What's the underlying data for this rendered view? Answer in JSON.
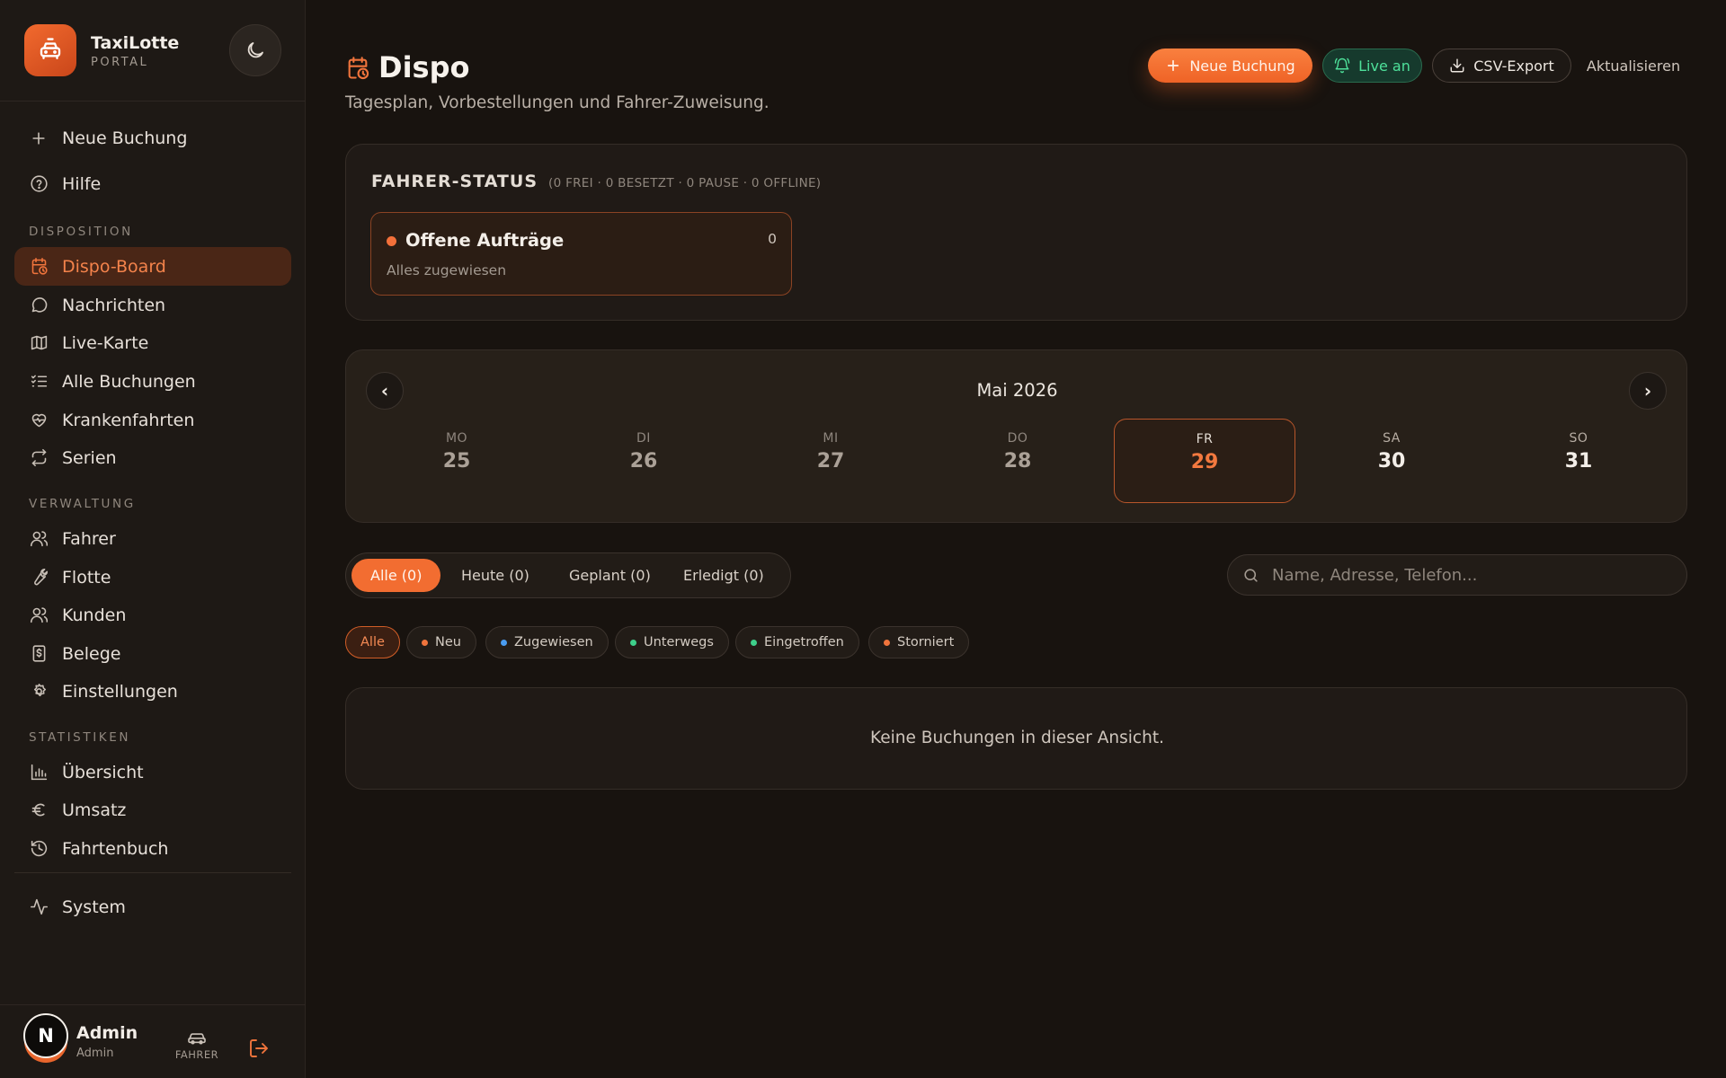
{
  "brand": {
    "name": "TaxiLotte",
    "sub": "PORTAL"
  },
  "sidebar": {
    "top_items": [
      {
        "label": "Neue Buchung",
        "icon": "plus-icon"
      },
      {
        "label": "Hilfe",
        "icon": "help-circle-icon"
      }
    ],
    "sections": [
      {
        "label": "DISPOSITION",
        "items": [
          {
            "label": "Dispo-Board",
            "icon": "calendar-clock-icon",
            "active": true
          },
          {
            "label": "Nachrichten",
            "icon": "message-icon"
          },
          {
            "label": "Live-Karte",
            "icon": "map-icon"
          },
          {
            "label": "Alle Buchungen",
            "icon": "list-checks-icon"
          },
          {
            "label": "Krankenfahrten",
            "icon": "heart-pulse-icon"
          },
          {
            "label": "Serien",
            "icon": "repeat-icon"
          }
        ]
      },
      {
        "label": "VERWALTUNG",
        "items": [
          {
            "label": "Fahrer",
            "icon": "users-icon"
          },
          {
            "label": "Flotte",
            "icon": "wrench-icon"
          },
          {
            "label": "Kunden",
            "icon": "users-icon"
          },
          {
            "label": "Belege",
            "icon": "receipt-icon"
          },
          {
            "label": "Einstellungen",
            "icon": "settings-icon"
          }
        ]
      },
      {
        "label": "STATISTIKEN",
        "items": [
          {
            "label": "Übersicht",
            "icon": "bar-chart-icon"
          },
          {
            "label": "Umsatz",
            "icon": "euro-icon"
          },
          {
            "label": "Fahrtenbuch",
            "icon": "history-icon"
          }
        ]
      }
    ],
    "bottom_items": [
      {
        "label": "System",
        "icon": "activity-icon"
      }
    ]
  },
  "user": {
    "initial": "N",
    "name": "Admin",
    "role": "Admin",
    "driver_label": "FAHRER"
  },
  "header": {
    "title": "Dispo",
    "subtitle": "Tagesplan, Vorbestellungen und Fahrer-Zuweisung.",
    "new_booking": "Neue Buchung",
    "live": "Live an",
    "export": "CSV-Export",
    "refresh": "Aktualisieren"
  },
  "driver_status": {
    "title": "FAHRER-STATUS",
    "meta": "(0 FREI · 0 BESETZT · 0 PAUSE · 0 OFFLINE)",
    "open_title": "Offene Aufträge",
    "open_count": "0",
    "open_sub": "Alles zugewiesen"
  },
  "calendar": {
    "month": "Mai 2026",
    "prev": "‹",
    "next": "›",
    "days": [
      {
        "dn": "MO",
        "dd": "25",
        "state": "past"
      },
      {
        "dn": "DI",
        "dd": "26",
        "state": "past"
      },
      {
        "dn": "MI",
        "dd": "27",
        "state": "past"
      },
      {
        "dn": "DO",
        "dd": "28",
        "state": "past"
      },
      {
        "dn": "FR",
        "dd": "29",
        "state": "selected"
      },
      {
        "dn": "SA",
        "dd": "30",
        "state": "future"
      },
      {
        "dn": "SO",
        "dd": "31",
        "state": "future"
      }
    ]
  },
  "tabs": [
    {
      "label": "Alle (0)",
      "active": true
    },
    {
      "label": "Heute (0)"
    },
    {
      "label": "Geplant (0)"
    },
    {
      "label": "Erledigt (0)"
    }
  ],
  "search": {
    "placeholder": "Name, Adresse, Telefon..."
  },
  "chips": [
    {
      "label": "Alle",
      "active": true
    },
    {
      "label": "Neu",
      "color": "#f0743c"
    },
    {
      "label": "Zugewiesen",
      "color": "#4a9cf0"
    },
    {
      "label": "Unterwegs",
      "color": "#3ecf8a"
    },
    {
      "label": "Eingetroffen",
      "color": "#3ecf8a"
    },
    {
      "label": "Storniert",
      "color": "#f0743c"
    }
  ],
  "empty": "Keine Buchungen in dieser Ansicht.",
  "colors": {
    "accent": "#f26d31",
    "live": "#4ee09a",
    "background": "#18130f"
  }
}
